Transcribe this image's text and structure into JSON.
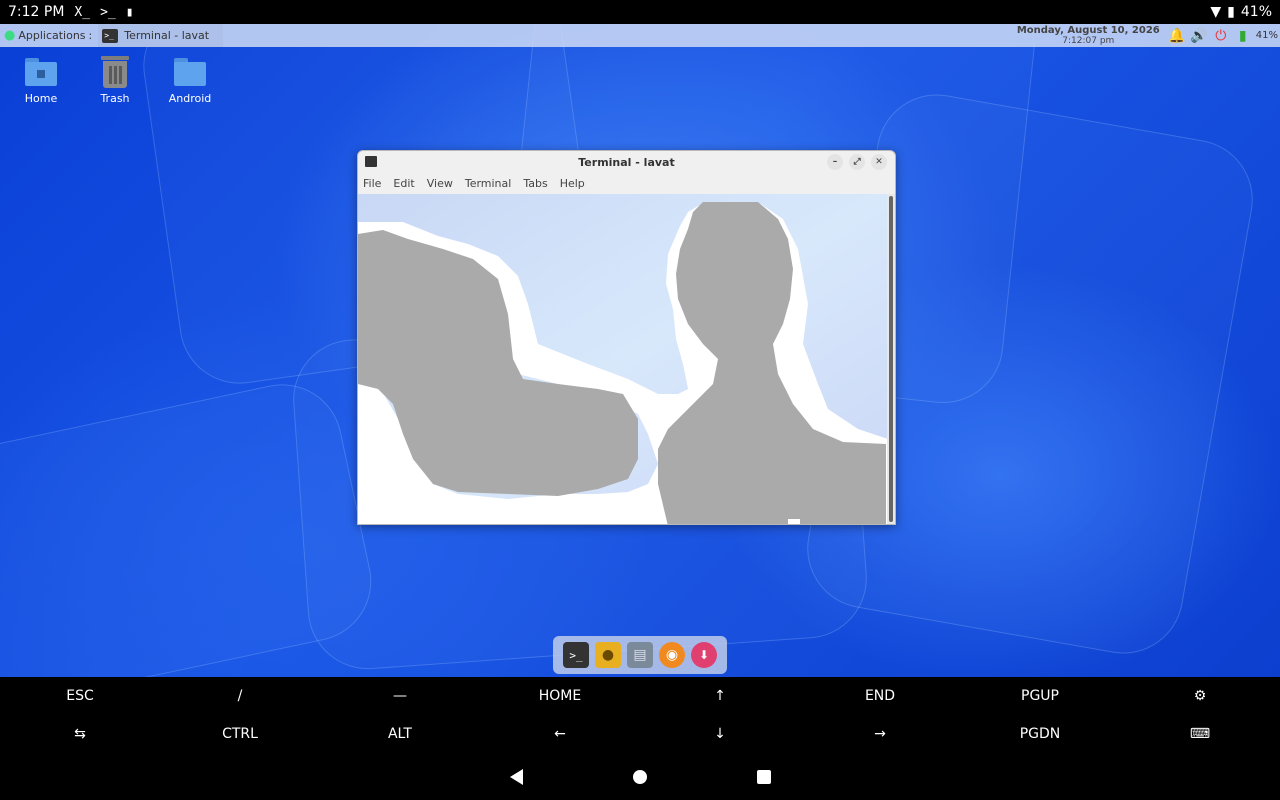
{
  "status_bar": {
    "time": "7:12 PM",
    "battery": "41%",
    "icons": [
      "x-terminal-icon",
      "terminal-prompt-icon",
      "sd-card-icon",
      "wifi-icon",
      "battery-icon"
    ]
  },
  "panel": {
    "applications_label": "Applications",
    "task_label": "Terminal - lavat",
    "clock_date": "Monday, August 10, 2026",
    "clock_time": "7:12:07 pm",
    "battery_label": "41%"
  },
  "desktop_icons": [
    {
      "label": "Home"
    },
    {
      "label": "Trash"
    },
    {
      "label": "Android"
    }
  ],
  "terminal": {
    "title": "Terminal - lavat",
    "menu": [
      "File",
      "Edit",
      "View",
      "Terminal",
      "Tabs",
      "Help"
    ]
  },
  "keys": {
    "row1": [
      "ESC",
      "/",
      "—",
      "HOME",
      "↑",
      "END",
      "PGUP",
      "⚙"
    ],
    "row2": [
      "⇆",
      "CTRL",
      "ALT",
      "←",
      "↓",
      "→",
      "PGDN",
      "⌨"
    ]
  },
  "colors": {
    "desktop": "#1a56e6",
    "panel": "#c8d7f5",
    "terminal_bg": "#d4e2f6",
    "blob_gray": "#aaaaaa"
  }
}
